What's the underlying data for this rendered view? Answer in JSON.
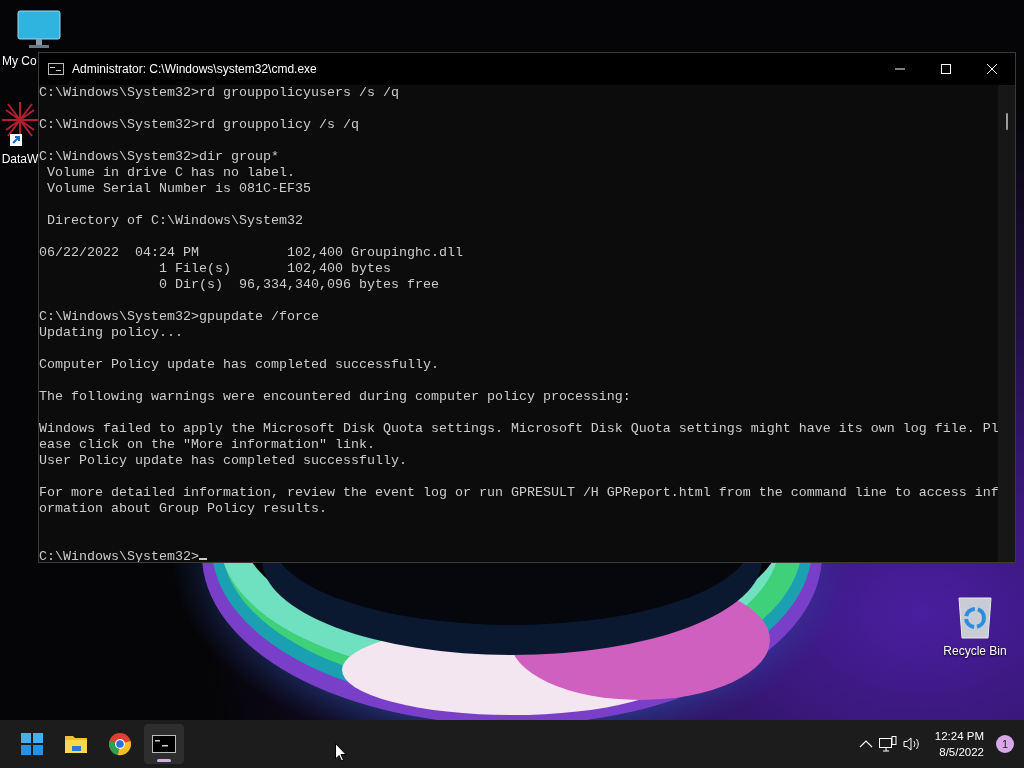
{
  "desktop_icons": [
    {
      "kind": "computer",
      "label": "My Co"
    },
    {
      "kind": "shortcut",
      "label": "DataW"
    },
    {
      "kind": "recycle",
      "label": "Recycle Bin"
    }
  ],
  "window": {
    "title": "Administrator: C:\\Windows\\system32\\cmd.exe",
    "lines": [
      {
        "kind": "text",
        "text": "C:\\Windows\\System32>rd grouppolicyusers /s /q"
      },
      {
        "kind": "blank"
      },
      {
        "kind": "text",
        "text": "C:\\Windows\\System32>rd grouppolicy /s /q"
      },
      {
        "kind": "blank"
      },
      {
        "kind": "text",
        "text": "C:\\Windows\\System32>dir group*"
      },
      {
        "kind": "text",
        "text": " Volume in drive C has no label."
      },
      {
        "kind": "text",
        "text": " Volume Serial Number is 081C-EF35"
      },
      {
        "kind": "blank"
      },
      {
        "kind": "text",
        "text": " Directory of C:\\Windows\\System32"
      },
      {
        "kind": "blank"
      },
      {
        "kind": "text",
        "text": "06/22/2022  04:24 PM           102,400 Groupinghc.dll"
      },
      {
        "kind": "text",
        "text": "               1 File(s)       102,400 bytes"
      },
      {
        "kind": "text",
        "text": "               0 Dir(s)  96,334,340,096 bytes free"
      },
      {
        "kind": "blank"
      },
      {
        "kind": "text",
        "text": "C:\\Windows\\System32>gpupdate /force"
      },
      {
        "kind": "text",
        "text": "Updating policy..."
      },
      {
        "kind": "blank"
      },
      {
        "kind": "text",
        "text": "Computer Policy update has completed successfully."
      },
      {
        "kind": "blank"
      },
      {
        "kind": "text",
        "text": "The following warnings were encountered during computer policy processing:"
      },
      {
        "kind": "blank"
      },
      {
        "kind": "text",
        "text": "Windows failed to apply the Microsoft Disk Quota settings. Microsoft Disk Quota settings might have its own log file. Pl"
      },
      {
        "kind": "text",
        "text": "ease click on the \"More information\" link."
      },
      {
        "kind": "text",
        "text": "User Policy update has completed successfully."
      },
      {
        "kind": "blank"
      },
      {
        "kind": "text",
        "text": "For more detailed information, review the event log or run GPRESULT /H GPReport.html from the command line to access inf"
      },
      {
        "kind": "text",
        "text": "ormation about Group Policy results."
      },
      {
        "kind": "blank"
      },
      {
        "kind": "blank"
      },
      {
        "kind": "prompt",
        "text": "C:\\Windows\\System32>"
      }
    ]
  },
  "taskbar": {
    "apps": [
      {
        "kind": "start",
        "selected": false
      },
      {
        "kind": "explorer",
        "selected": false
      },
      {
        "kind": "browser",
        "selected": false
      },
      {
        "kind": "terminal",
        "selected": true
      }
    ],
    "time": "12:24 PM",
    "date": "8/5/2022",
    "notification_count": "1"
  }
}
